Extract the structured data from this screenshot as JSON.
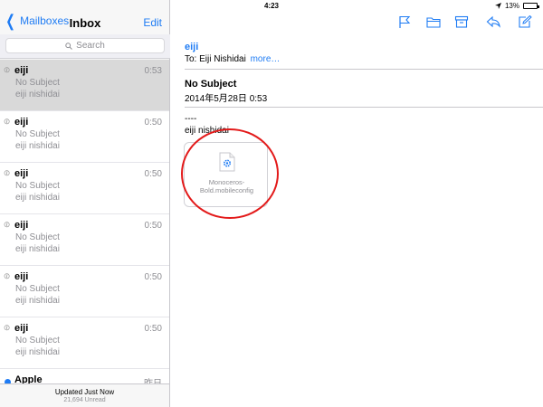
{
  "status": {
    "device": "iPad",
    "time": "4:23",
    "battery_text": "13%",
    "battery_level": 0.13
  },
  "left": {
    "back_label": "Mailboxes",
    "title": "Inbox",
    "edit_label": "Edit",
    "search_placeholder": "Search",
    "messages": [
      {
        "from": "eiji",
        "time": "0:53",
        "subject": "No Subject",
        "preview": "eiji nishidai"
      },
      {
        "from": "eiji",
        "time": "0:50",
        "subject": "No Subject",
        "preview": "eiji nishidai"
      },
      {
        "from": "eiji",
        "time": "0:50",
        "subject": "No Subject",
        "preview": "eiji nishidai"
      },
      {
        "from": "eiji",
        "time": "0:50",
        "subject": "No Subject",
        "preview": "eiji nishidai"
      },
      {
        "from": "eiji",
        "time": "0:50",
        "subject": "No Subject",
        "preview": "eiji nishidai"
      },
      {
        "from": "eiji",
        "time": "0:50",
        "subject": "No Subject",
        "preview": "eiji nishidai"
      },
      {
        "from": "Apple",
        "time": "昨日",
        "subject": "",
        "preview": ""
      }
    ],
    "footer_updated": "Updated Just Now",
    "footer_unread": "21,694 Unread"
  },
  "toolbar": {
    "icons": [
      "flag-icon",
      "folder-icon",
      "archive-icon",
      "reply-icon",
      "compose-icon"
    ]
  },
  "message": {
    "sender": "eiji",
    "to_prefix": "To:",
    "to_name": "Eiji Nishidai",
    "more_label": "more…",
    "subject": "No Subject",
    "date": "2014年5月28日 0:53",
    "signature_sep": "----",
    "signature_name": "eiji nishidai",
    "attachment_name": "Monoceros-Bold.mobileconfig"
  },
  "colors": {
    "accent": "#1f7cf4",
    "highlight_circle": "#e31a1a",
    "selected_row": "#d9d9d9"
  }
}
